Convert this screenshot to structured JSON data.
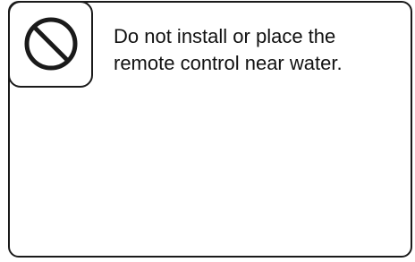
{
  "notice": {
    "icon": "prohibition-icon",
    "line1": "Do not install or place the",
    "line2": "remote control near water."
  },
  "colors": {
    "stroke": "#1a1a1a",
    "text": "#111111",
    "background": "#ffffff"
  }
}
